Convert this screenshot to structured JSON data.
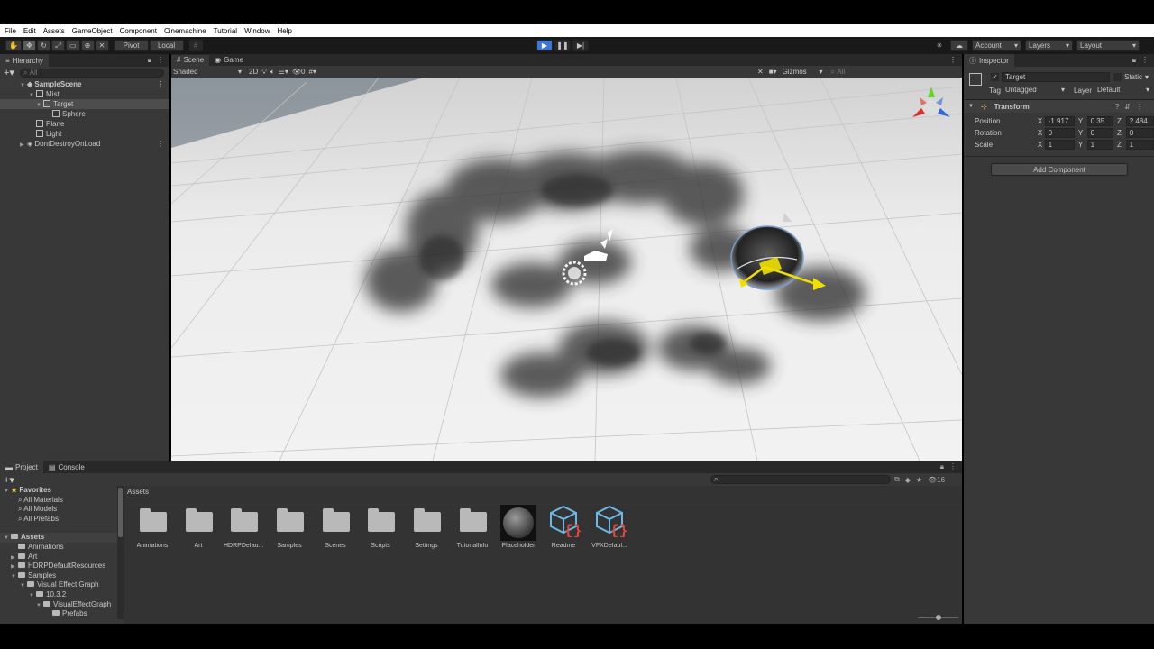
{
  "menu": [
    "File",
    "Edit",
    "Assets",
    "GameObject",
    "Component",
    "Cinemachine",
    "Tutorial",
    "Window",
    "Help"
  ],
  "toolbar": {
    "pivot": "Pivot",
    "local": "Local",
    "account": "Account",
    "layers": "Layers",
    "layout": "Layout"
  },
  "hierarchy": {
    "tab": "Hierarchy",
    "search_placeholder": "All",
    "items": [
      {
        "label": "SampleScene"
      },
      {
        "label": "Mist"
      },
      {
        "label": "Target"
      },
      {
        "label": "Sphere"
      },
      {
        "label": "Plane"
      },
      {
        "label": "Light"
      },
      {
        "label": "DontDestroyOnLoad"
      }
    ]
  },
  "scene": {
    "tab_scene": "Scene",
    "tab_game": "Game",
    "shading": "Shaded",
    "mode_2d": "2D",
    "hidden_count": "0",
    "gizmos": "Gizmos",
    "search_placeholder": "All"
  },
  "inspector": {
    "tab": "Inspector",
    "object_name": "Target",
    "static_label": "Static",
    "tag_label": "Tag",
    "tag_value": "Untagged",
    "layer_label": "Layer",
    "layer_value": "Default",
    "component": "Transform",
    "rows": [
      {
        "label": "Position",
        "x": "-1.917",
        "y": "0.35",
        "z": "2.484"
      },
      {
        "label": "Rotation",
        "x": "0",
        "y": "0",
        "z": "0"
      },
      {
        "label": "Scale",
        "x": "1",
        "y": "1",
        "z": "1"
      }
    ],
    "axis_x": "X",
    "axis_y": "Y",
    "axis_z": "Z",
    "add_component": "Add Component"
  },
  "project": {
    "tab_project": "Project",
    "tab_console": "Console",
    "count": "16",
    "breadcrumb": "Assets",
    "favorites": "Favorites",
    "fav_items": [
      "All Materials",
      "All Models",
      "All Prefabs"
    ],
    "assets_root": "Assets",
    "tree": [
      "Animations",
      "Art",
      "HDRPDefaultResources",
      "Samples",
      "Visual Effect Graph",
      "10.3.2",
      "VisualEffectGraph",
      "Prefabs"
    ],
    "grid": [
      {
        "label": "Animations",
        "type": "folder"
      },
      {
        "label": "Art",
        "type": "folder"
      },
      {
        "label": "HDRPDefau...",
        "type": "folder"
      },
      {
        "label": "Samples",
        "type": "folder"
      },
      {
        "label": "Scenes",
        "type": "folder"
      },
      {
        "label": "Scripts",
        "type": "folder"
      },
      {
        "label": "Settings",
        "type": "folder"
      },
      {
        "label": "TutorialInfo",
        "type": "folder"
      },
      {
        "label": "Placeholder",
        "type": "material"
      },
      {
        "label": "Readme",
        "type": "script-cube"
      },
      {
        "label": "VFXDefaul...",
        "type": "script-cube"
      }
    ]
  },
  "colors": {
    "play_active": "#3d76d4",
    "gizmo_yellow": "#f0e000",
    "axis_red": "#e0302c",
    "axis_green": "#6ad12f",
    "axis_blue": "#2c66e0"
  }
}
